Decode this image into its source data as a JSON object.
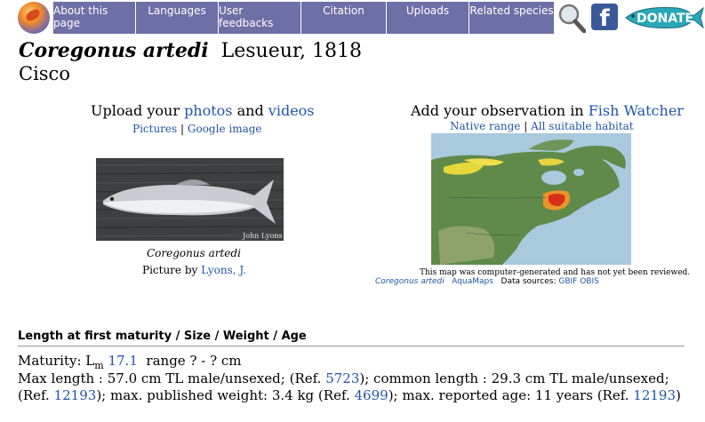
{
  "nav": {
    "items": [
      "About this page",
      "Languages",
      "User feedbacks",
      "Citation",
      "Uploads",
      "Related species"
    ],
    "donate_label": "DONATE"
  },
  "species": {
    "genus": "Coregonus artedi",
    "author": "Lesueur, 1818",
    "common_name": "Cisco"
  },
  "photo_section": {
    "upload_prefix": "Upload your",
    "photos_link": "photos",
    "and": "and",
    "videos_link": "videos",
    "pictures_link": "Pictures",
    "sep": "|",
    "google_link": "Google image",
    "credit_overlay": "John Lyons",
    "caption": "Coregonus artedi",
    "picture_by": "Picture by",
    "author_link": "Lyons, J."
  },
  "map_section": {
    "obs_prefix": "Add your observation in",
    "fish_watcher_link": "Fish Watcher",
    "native_range_link": "Native range",
    "sep": "|",
    "suitable_link": "All suitable habitat",
    "note": "This map was computer-generated and has not yet been reviewed.",
    "species_link": "Coregonus artedi",
    "aquamaps_link": "AquaMaps",
    "data_sources": "Data sources:",
    "gbif_link": "GBIF",
    "obis_link": "OBIS"
  },
  "size_section": {
    "heading": "Length at first maturity / Size / Weight / Age",
    "maturity_label": "Maturity: L",
    "maturity_sub": "m",
    "maturity_value": "17.1",
    "range_text": "range ? - ? cm",
    "max_length_text": "Max length : 57.0 cm TL male/unsexed; (Ref.",
    "ref1": "5723",
    "common_length_text": "); common length : 29.3 cm TL male/unsexed; (Ref.",
    "ref2": "12193",
    "weight_text": "); max. published weight: 3.4 kg (Ref.",
    "ref3": "4699",
    "age_text": "); max. reported age: 11 years (Ref.",
    "ref4": "12193",
    "close": ")"
  },
  "colors": {
    "nav_bg": "#6d6fa6",
    "link": "#2255aa",
    "donate_bg": "#2aa7b8",
    "facebook": "#3b5998"
  },
  "icons": [
    "logo-icon",
    "search-icon",
    "facebook-icon",
    "donate-fish-icon"
  ]
}
